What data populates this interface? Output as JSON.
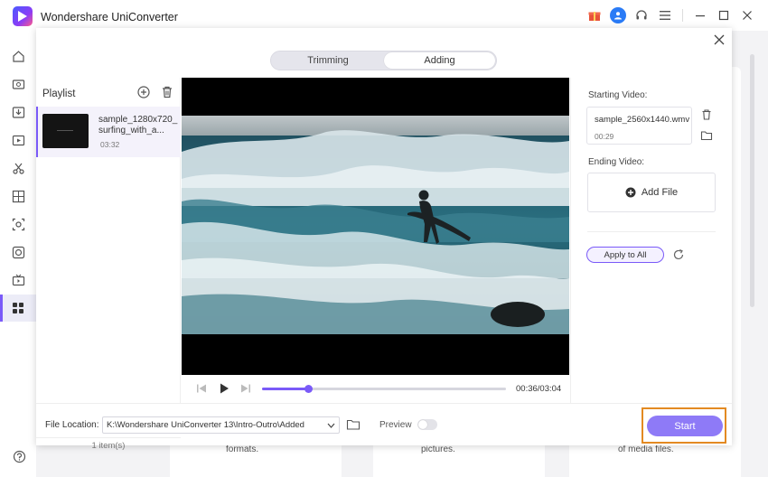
{
  "app": {
    "title": "Wondershare UniConverter"
  },
  "background": {
    "captions": [
      "formats.",
      "pictures.",
      "of media files."
    ]
  },
  "dialog": {
    "tabs": [
      {
        "label": "Trimming",
        "active": false
      },
      {
        "label": "Adding",
        "active": true
      }
    ],
    "playlist": {
      "title": "Playlist",
      "items": [
        {
          "name": "sample_1280x720_surfing_with_a...",
          "duration": "03:32"
        }
      ],
      "count_label": "1 item(s)"
    },
    "player": {
      "time": "00:36/03:04",
      "progress": 0.19
    },
    "starting_video": {
      "label": "Starting Video:",
      "file_name": "sample_2560x1440.wmv",
      "duration": "00:29"
    },
    "ending_video": {
      "label": "Ending Video:",
      "add_file_label": "Add File"
    },
    "apply_to_all_label": "Apply to All",
    "footer": {
      "file_location_label": "File Location:",
      "file_location_value": "K:\\Wondershare UniConverter 13\\Intro-Outro\\Added",
      "preview_label": "Preview",
      "preview_on": false,
      "start_label": "Start"
    }
  },
  "colors": {
    "accent": "#7a5af8",
    "start_button": "#8e7af7",
    "highlight_border": "#e38a22"
  }
}
